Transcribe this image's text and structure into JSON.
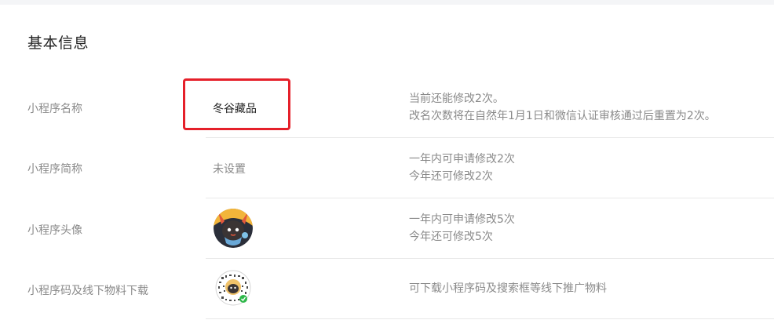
{
  "section": {
    "title": "基本信息"
  },
  "rows": [
    {
      "label": "小程序名称",
      "value": "冬谷藏品",
      "desc_line1": "当前还能修改2次。",
      "desc_line2": "改名次数将在自然年1月1日和微信认证审核通过后重置为2次。"
    },
    {
      "label": "小程序简称",
      "value": "未设置",
      "desc_line1": "一年内可申请修改2次",
      "desc_line2": "今年还可修改2次"
    },
    {
      "label": "小程序头像",
      "desc_line1": "一年内可申请修改5次",
      "desc_line2": "今年还可修改5次"
    },
    {
      "label": "小程序码及线下物料下载",
      "desc_line1": "可下载小程序码及搜索框等线下推广物料"
    }
  ],
  "colors": {
    "highlight": "#e5202a",
    "label": "#8a8a8a",
    "value": "#222222",
    "divider": "#e8e8e8"
  },
  "icons": {
    "avatar": "mini-program-avatar-icon",
    "qrcode": "mini-program-code-icon"
  }
}
